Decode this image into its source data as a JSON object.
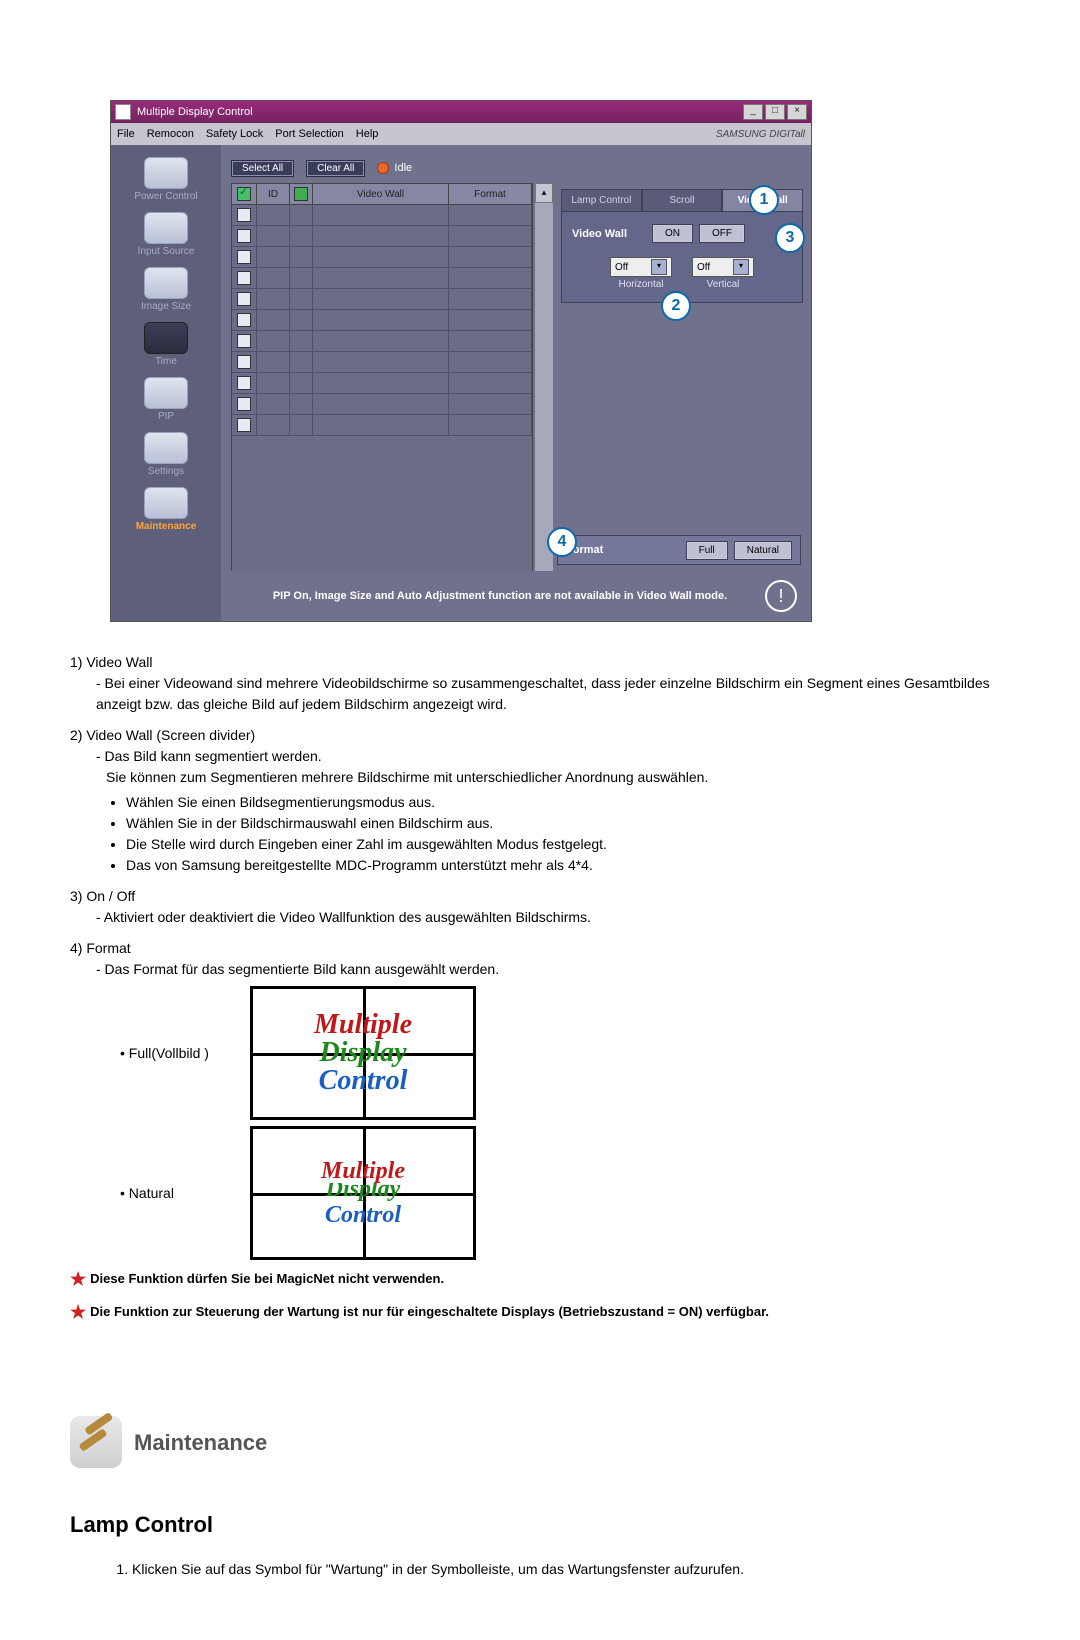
{
  "app": {
    "title": "Multiple Display Control",
    "menu": [
      "File",
      "Remocon",
      "Safety Lock",
      "Port Selection",
      "Help"
    ],
    "brand": "SAMSUNG DIGITall"
  },
  "sidebar": {
    "items": [
      {
        "label": "Power Control"
      },
      {
        "label": "Input Source"
      },
      {
        "label": "Image Size"
      },
      {
        "label": "Time"
      },
      {
        "label": "PIP"
      },
      {
        "label": "Settings"
      },
      {
        "label": "Maintenance"
      }
    ]
  },
  "toolbar": {
    "select_all": "Select All",
    "clear_all": "Clear All",
    "idle": "Idle"
  },
  "grid": {
    "headers": {
      "id": "ID",
      "videowall": "Video Wall",
      "format": "Format"
    }
  },
  "tabs": {
    "lamp": "Lamp Control",
    "scroll": "Scroll",
    "videowall": "Video Wall"
  },
  "panel": {
    "videowall_label": "Video Wall",
    "on": "ON",
    "off": "OFF",
    "dd_h_value": "Off",
    "dd_h_label": "Horizontal",
    "dd_v_value": "Off",
    "dd_v_label": "Vertical",
    "format_label": "Format",
    "full": "Full",
    "natural": "Natural"
  },
  "callouts": {
    "c1": "1",
    "c2": "2",
    "c3": "3",
    "c4": "4"
  },
  "footer": {
    "text": "PIP On, Image Size and Auto Adjustment function are not available in Video Wall mode."
  },
  "doc": {
    "i1_title": "1) Video Wall",
    "i1_l1": "- Bei einer Videowand sind mehrere Videobildschirme so zusammengeschaltet, dass jeder einzelne Bildschirm ein Segment eines Gesamtbildes anzeigt bzw. das gleiche Bild auf jedem Bildschirm angezeigt wird.",
    "i2_title": "2) Video Wall (Screen divider)",
    "i2_l1": "- Das Bild kann segmentiert werden.",
    "i2_l2": "Sie können zum Segmentieren mehrere Bildschirme mit unterschiedlicher Anordnung auswählen.",
    "i2_b1": "Wählen Sie einen Bildsegmentierungsmodus aus.",
    "i2_b2": "Wählen Sie in der Bildschirmauswahl einen Bildschirm aus.",
    "i2_b3": "Die Stelle wird durch Eingeben einer Zahl im ausgewählten Modus festgelegt.",
    "i2_b4": "Das von Samsung bereitgestellte MDC-Programm unterstützt mehr als 4*4.",
    "i3_title": "3) On / Off",
    "i3_l1": "- Aktiviert oder deaktiviert die Video Wallfunktion des ausgewählten Bildschirms.",
    "i4_title": "4) Format",
    "i4_l1": "- Das Format für das segmentierte Bild kann ausgewählt werden.",
    "fmt_full": "Full(Vollbild )",
    "fmt_natural": "Natural",
    "mdc1": "Mul",
    "mdc2": "tiple",
    "mdc3": "Dis",
    "mdc4": "play",
    "mdc5": "Con",
    "mdc6": "trol",
    "note1": "Diese Funktion dürfen Sie bei MagicNet nicht verwenden.",
    "note2": "Die Funktion zur Steuerung der Wartung ist nur für eingeschaltete Displays (Betriebszustand = ON) verfügbar.",
    "maint_heading": "Maintenance",
    "lamp_heading": "Lamp Control",
    "lamp_step1": "Klicken Sie auf das Symbol für \"Wartung\" in der Symbolleiste, um das Wartungsfenster aufzurufen."
  }
}
